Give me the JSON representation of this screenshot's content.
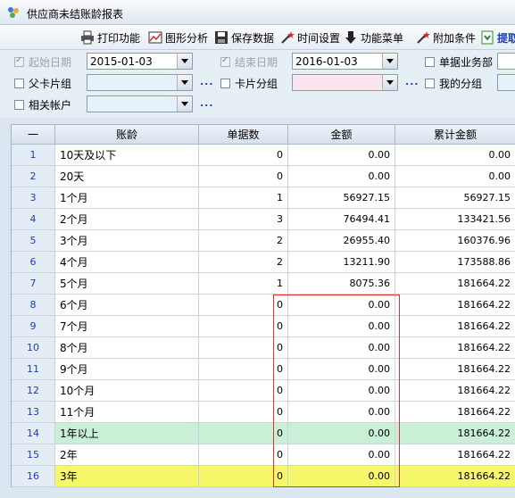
{
  "window": {
    "title": "供应商未结账龄报表"
  },
  "toolbar": {
    "print": "打印功能",
    "chart": "图形分析",
    "save": "保存数据",
    "time": "时间设置",
    "menu": "功能菜单",
    "extra": "附加条件",
    "submit": "提取"
  },
  "filters": {
    "start_label": "起始日期",
    "start_value": "2015-01-03",
    "end_label": "结束日期",
    "end_value": "2016-01-03",
    "biz_label": "单据业务部",
    "parent_label": "父卡片组",
    "card_label": "卡片分组",
    "mygroup_label": "我的分组",
    "account_label": "相关帐户",
    "dots": "..."
  },
  "table": {
    "headers": {
      "num": "一",
      "age": "账龄",
      "count": "单据数",
      "amount": "金额",
      "cumulative": "累计金额"
    },
    "rows": [
      {
        "n": "1",
        "age": "10天及以下",
        "count": "0",
        "amount": "0.00",
        "cum": "0.00"
      },
      {
        "n": "2",
        "age": "20天",
        "count": "0",
        "amount": "0.00",
        "cum": "0.00"
      },
      {
        "n": "3",
        "age": "1个月",
        "count": "1",
        "amount": "56927.15",
        "cum": "56927.15"
      },
      {
        "n": "4",
        "age": "2个月",
        "count": "3",
        "amount": "76494.41",
        "cum": "133421.56"
      },
      {
        "n": "5",
        "age": "3个月",
        "count": "2",
        "amount": "26955.40",
        "cum": "160376.96"
      },
      {
        "n": "6",
        "age": "4个月",
        "count": "2",
        "amount": "13211.90",
        "cum": "173588.86"
      },
      {
        "n": "7",
        "age": "5个月",
        "count": "1",
        "amount": "8075.36",
        "cum": "181664.22"
      },
      {
        "n": "8",
        "age": "6个月",
        "count": "0",
        "amount": "0.00",
        "cum": "181664.22"
      },
      {
        "n": "9",
        "age": "7个月",
        "count": "0",
        "amount": "0.00",
        "cum": "181664.22"
      },
      {
        "n": "10",
        "age": "8个月",
        "count": "0",
        "amount": "0.00",
        "cum": "181664.22"
      },
      {
        "n": "11",
        "age": "9个月",
        "count": "0",
        "amount": "0.00",
        "cum": "181664.22"
      },
      {
        "n": "12",
        "age": "10个月",
        "count": "0",
        "amount": "0.00",
        "cum": "181664.22"
      },
      {
        "n": "13",
        "age": "11个月",
        "count": "0",
        "amount": "0.00",
        "cum": "181664.22"
      },
      {
        "n": "14",
        "age": "1年以上",
        "count": "0",
        "amount": "0.00",
        "cum": "181664.22"
      },
      {
        "n": "15",
        "age": "2年",
        "count": "0",
        "amount": "0.00",
        "cum": "181664.22"
      },
      {
        "n": "16",
        "age": "3年",
        "count": "0",
        "amount": "0.00",
        "cum": "181664.22"
      }
    ]
  },
  "colors": {
    "green_row": "#c9f0d6",
    "yellow_row": "#f7f76a",
    "highlight_box": "#e03030"
  }
}
